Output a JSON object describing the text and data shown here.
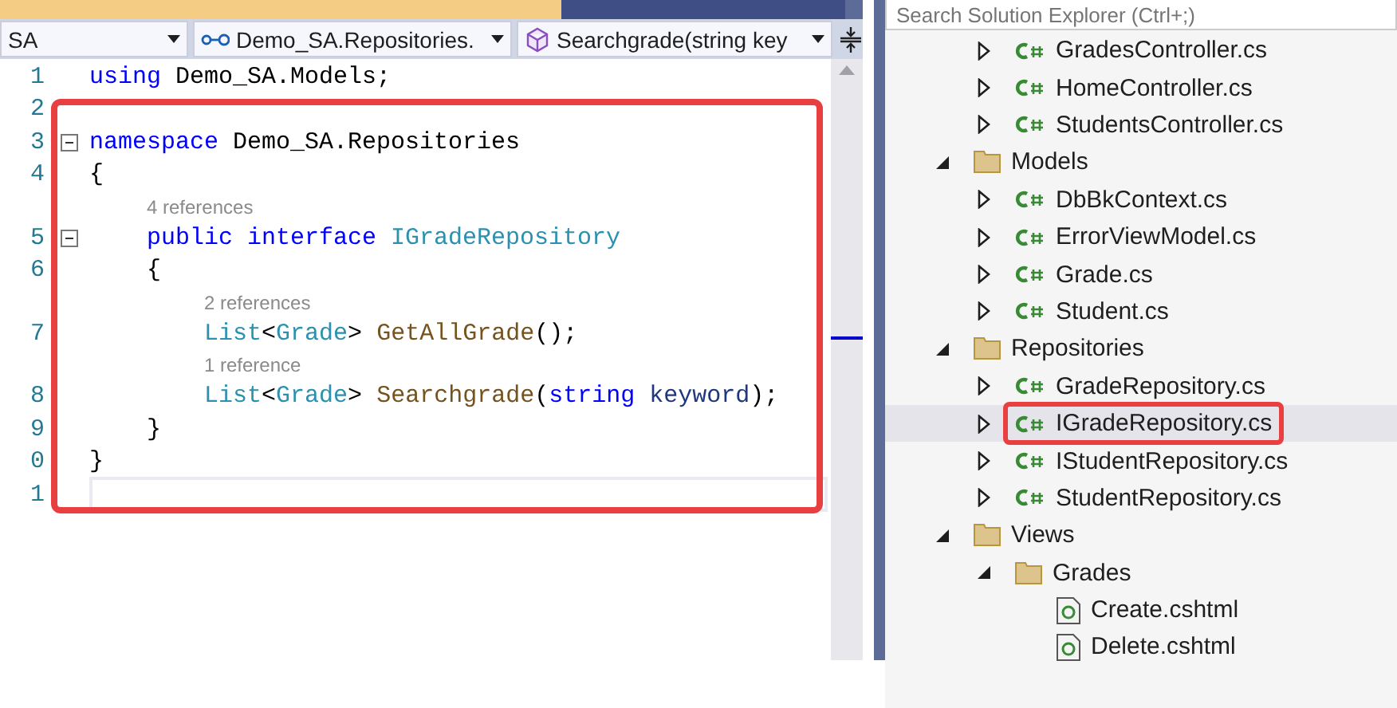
{
  "editor": {
    "tabs": [
      {
        "selected": true
      },
      {
        "selected": false
      }
    ],
    "nav": [
      {
        "kind": "plain",
        "text": "SA"
      },
      {
        "kind": "namespace",
        "text": "Demo_SA.Repositories."
      },
      {
        "kind": "member",
        "text": "Searchgrade(string key"
      }
    ],
    "annotation_box": true,
    "lines": [
      {
        "number": "1",
        "current": false,
        "tokens": [
          {
            "kind": "keyword",
            "text": "using"
          },
          {
            "kind": "plain",
            "text": " Demo_SA.Models;"
          }
        ]
      },
      {
        "number": "2",
        "current": false
      },
      {
        "number": "3",
        "current": false,
        "folded": false,
        "tokens": [
          {
            "kind": "keyword",
            "text": "namespace"
          },
          {
            "kind": "plain",
            "text": " Demo_SA.Repositories"
          }
        ],
        "block": {
          "open": {
            "number": "4",
            "current": false,
            "tokens": [
              {
                "kind": "plain",
                "text": "{"
              }
            ]
          },
          "children": [
            {
              "lens": "4 references",
              "number": "5",
              "current": false,
              "folded": false,
              "tokens": [
                {
                  "kind": "keyword",
                  "text": "public"
                },
                {
                  "kind": "keyword",
                  "text": " interface"
                },
                {
                  "kind": "type",
                  "text": " IGradeRepository"
                }
              ],
              "block": {
                "open": {
                  "number": "6",
                  "current": false,
                  "tokens": [
                    {
                      "kind": "plain",
                      "text": "{"
                    }
                  ]
                },
                "children": [
                  {
                    "lens": "2 references",
                    "number": "7",
                    "current": false,
                    "tokens": [
                      {
                        "kind": "type",
                        "text": "List"
                      },
                      {
                        "kind": "plain",
                        "text": "<"
                      },
                      {
                        "kind": "type",
                        "text": "Grade"
                      },
                      {
                        "kind": "plain",
                        "text": ">"
                      },
                      {
                        "kind": "method",
                        "text": " GetAllGrade"
                      },
                      {
                        "kind": "plain",
                        "text": "();"
                      }
                    ]
                  },
                  {
                    "lens": "1 reference",
                    "number": "8",
                    "current": false,
                    "tokens": [
                      {
                        "kind": "type",
                        "text": "List"
                      },
                      {
                        "kind": "plain",
                        "text": "<"
                      },
                      {
                        "kind": "type",
                        "text": "Grade"
                      },
                      {
                        "kind": "plain",
                        "text": ">"
                      },
                      {
                        "kind": "method",
                        "text": " Searchgrade"
                      },
                      {
                        "kind": "plain",
                        "text": "("
                      },
                      {
                        "kind": "keyword",
                        "text": "string"
                      },
                      {
                        "kind": "param",
                        "text": " keyword"
                      },
                      {
                        "kind": "plain",
                        "text": ");"
                      }
                    ]
                  }
                ],
                "close": {
                  "number": "9",
                  "current": false,
                  "tokens": [
                    {
                      "kind": "plain",
                      "text": "}"
                    }
                  ]
                }
              }
            }
          ],
          "close": {
            "number": "0",
            "current": false,
            "tokens": [
              {
                "kind": "plain",
                "text": "}"
              }
            ]
          }
        }
      },
      {
        "number": "1",
        "current": true
      }
    ]
  },
  "solution_explorer": {
    "search": {
      "placeholder": "Search Solution Explorer (Ctrl+;)"
    },
    "items": [
      {
        "children": [
          {
            "kind": "cs",
            "label": "GradesController.cs",
            "expanded": false,
            "selected": false,
            "highlighted": false
          },
          {
            "kind": "cs",
            "label": "HomeController.cs",
            "expanded": false,
            "selected": false,
            "highlighted": false
          },
          {
            "kind": "cs",
            "label": "StudentsController.cs",
            "expanded": false,
            "selected": false,
            "highlighted": false
          }
        ]
      },
      {
        "kind": "folder",
        "label": "Models",
        "expanded": true,
        "selected": false,
        "highlighted": false,
        "children": [
          {
            "kind": "cs",
            "label": "DbBkContext.cs",
            "expanded": false,
            "selected": false,
            "highlighted": false
          },
          {
            "kind": "cs",
            "label": "ErrorViewModel.cs",
            "expanded": false,
            "selected": false,
            "highlighted": false
          },
          {
            "kind": "cs",
            "label": "Grade.cs",
            "expanded": false,
            "selected": false,
            "highlighted": false
          },
          {
            "kind": "cs",
            "label": "Student.cs",
            "expanded": false,
            "selected": false,
            "highlighted": false
          }
        ]
      },
      {
        "kind": "folder",
        "label": "Repositories",
        "expanded": true,
        "selected": false,
        "highlighted": false,
        "children": [
          {
            "kind": "cs",
            "label": "GradeRepository.cs",
            "expanded": false,
            "selected": false,
            "highlighted": false
          },
          {
            "kind": "cs",
            "label": "IGradeRepository.cs",
            "expanded": false,
            "selected": true,
            "highlighted": true
          },
          {
            "kind": "cs",
            "label": "IStudentRepository.cs",
            "expanded": false,
            "selected": false,
            "highlighted": false
          },
          {
            "kind": "cs",
            "label": "StudentRepository.cs",
            "expanded": false,
            "selected": false,
            "highlighted": false
          }
        ]
      },
      {
        "kind": "folder",
        "label": "Views",
        "expanded": true,
        "selected": false,
        "highlighted": false,
        "children": [
          {
            "kind": "folder",
            "label": "Grades",
            "expanded": true,
            "selected": false,
            "highlighted": false,
            "children": [
              {
                "kind": "cshtml",
                "label": "Create.cshtml",
                "selected": false,
                "highlighted": false
              },
              {
                "kind": "cshtml",
                "label": "Delete.cshtml",
                "selected": false,
                "highlighted": false
              }
            ]
          }
        ]
      }
    ]
  }
}
